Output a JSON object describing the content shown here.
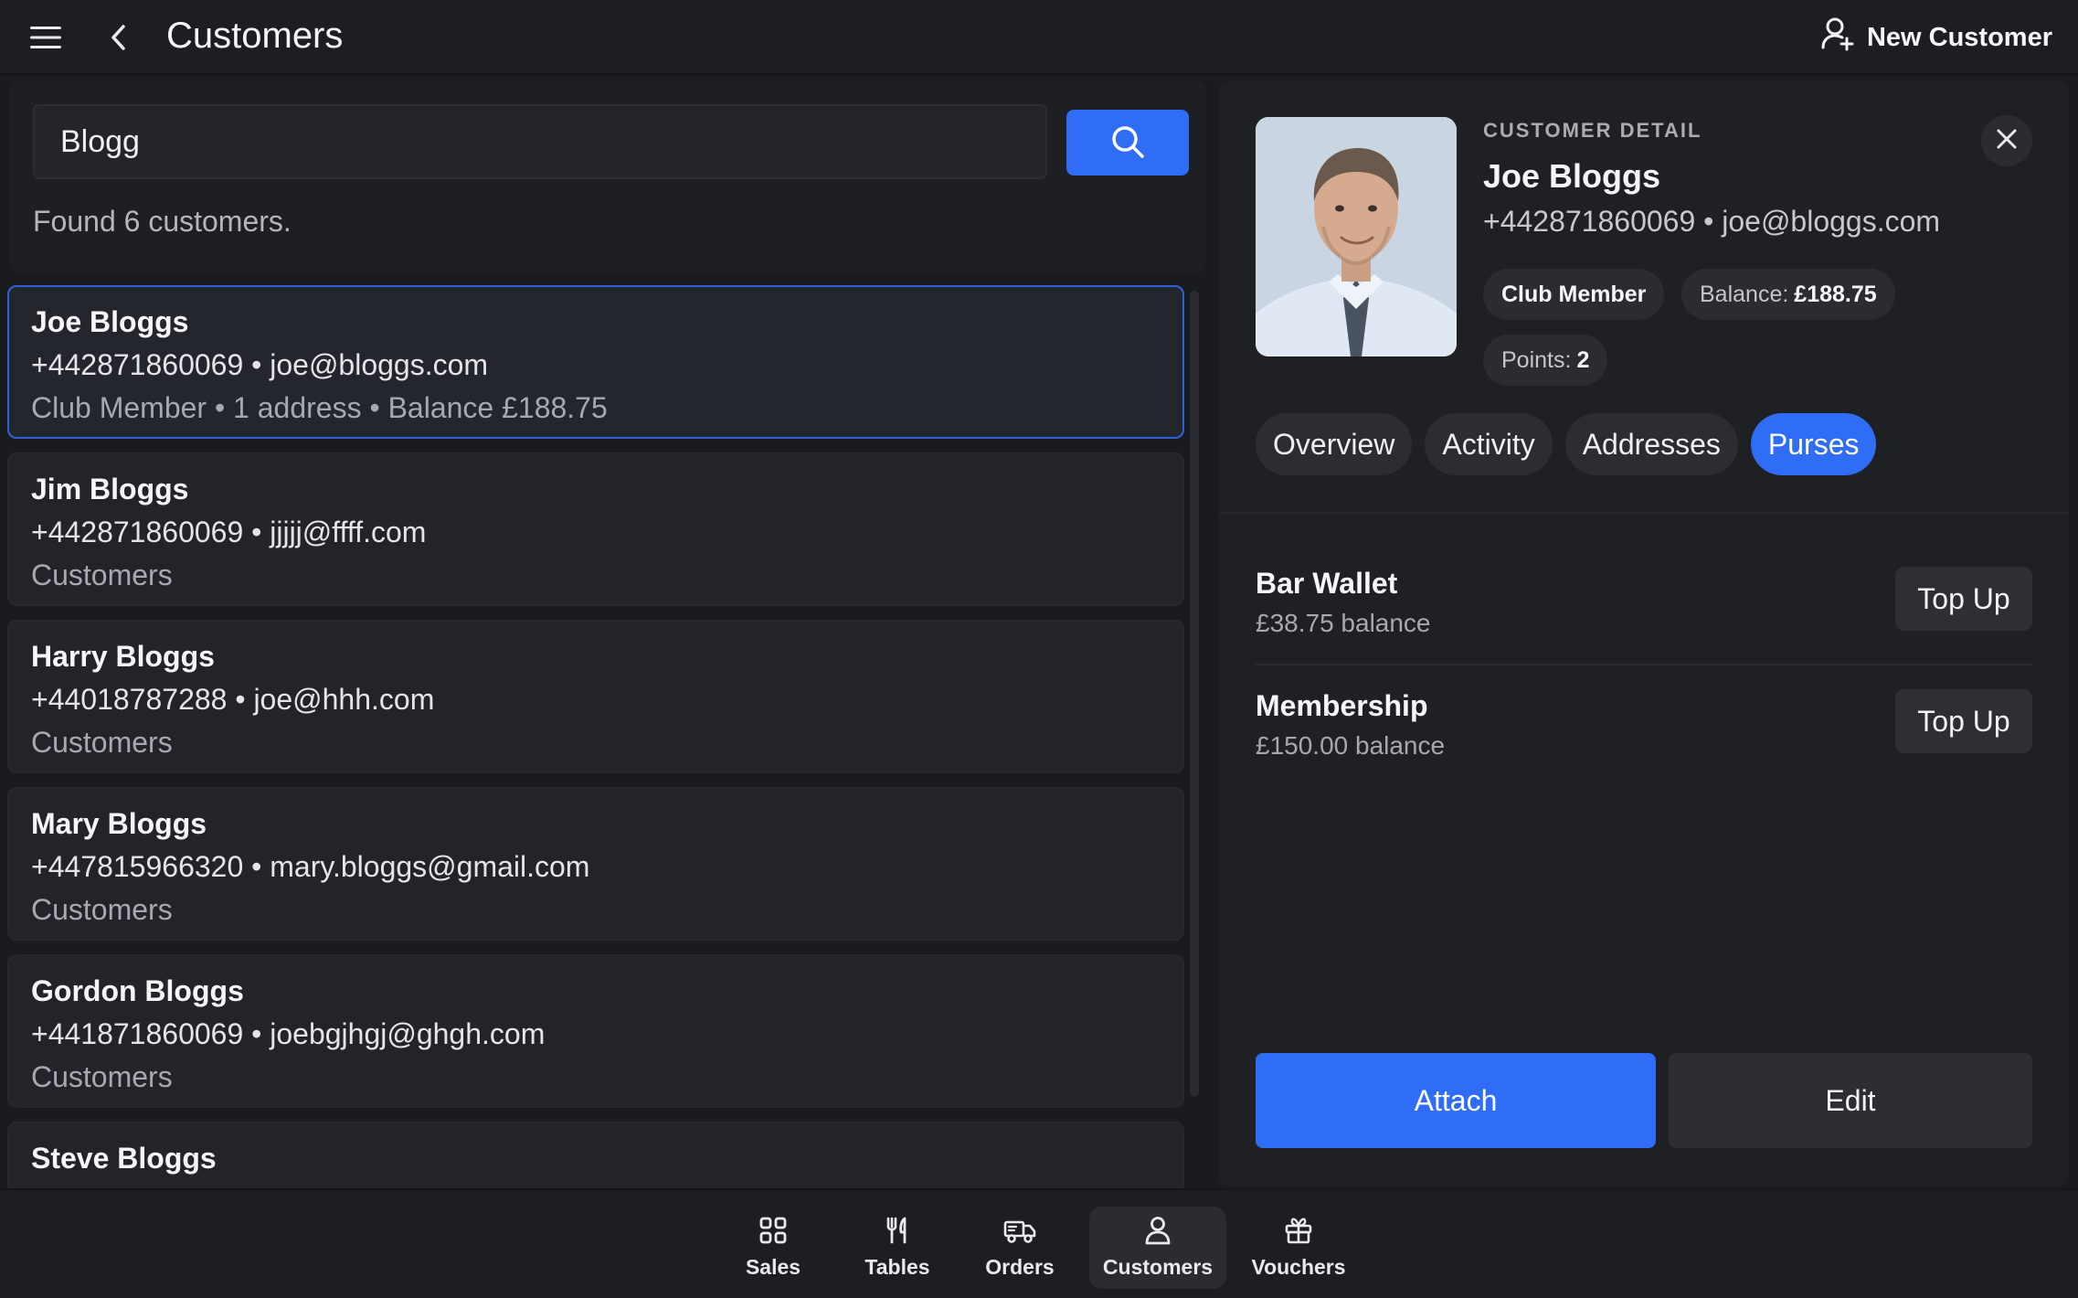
{
  "header": {
    "title": "Customers",
    "new_customer_label": "New Customer"
  },
  "search": {
    "value": "Blogg",
    "placeholder": "",
    "found_text": "Found 6 customers."
  },
  "customers": [
    {
      "name": "Joe Bloggs",
      "contact": "+442871860069 • joe@bloggs.com",
      "meta": "Club Member • 1 address • Balance £188.75"
    },
    {
      "name": "Jim Bloggs",
      "contact": "+442871860069 • jjjjj@ffff.com",
      "meta": "Customers"
    },
    {
      "name": "Harry Bloggs",
      "contact": "+44018787288 • joe@hhh.com",
      "meta": "Customers"
    },
    {
      "name": "Mary Bloggs",
      "contact": "+447815966320 • mary.bloggs@gmail.com",
      "meta": "Customers"
    },
    {
      "name": "Gordon Bloggs",
      "contact": "+441871860069 • joebgjhgj@ghgh.com",
      "meta": "Customers"
    },
    {
      "name": "Steve Bloggs",
      "contact": "",
      "meta": ""
    }
  ],
  "detail": {
    "eyebrow": "CUSTOMER DETAIL",
    "name": "Joe Bloggs",
    "contact": "+442871860069 • joe@bloggs.com",
    "chips": {
      "group": "Club Member",
      "balance_label": "Balance:",
      "balance_value": "£188.75",
      "points_label": "Points:",
      "points_value": "2"
    },
    "tabs": [
      "Overview",
      "Activity",
      "Addresses",
      "Purses"
    ],
    "active_tab": "Purses",
    "purses": [
      {
        "name": "Bar Wallet",
        "balance": "£38.75 balance",
        "action": "Top Up"
      },
      {
        "name": "Membership",
        "balance": "£150.00 balance",
        "action": "Top Up"
      }
    ],
    "attach_label": "Attach",
    "edit_label": "Edit"
  },
  "bottom_nav": [
    {
      "label": "Sales",
      "icon": "grid-icon"
    },
    {
      "label": "Tables",
      "icon": "cutlery-icon"
    },
    {
      "label": "Orders",
      "icon": "truck-icon"
    },
    {
      "label": "Customers",
      "icon": "person-icon"
    },
    {
      "label": "Vouchers",
      "icon": "gift-icon"
    }
  ],
  "colors": {
    "accent": "#2f6df6",
    "background": "#1a1b1e",
    "panel": "#1e2024"
  }
}
